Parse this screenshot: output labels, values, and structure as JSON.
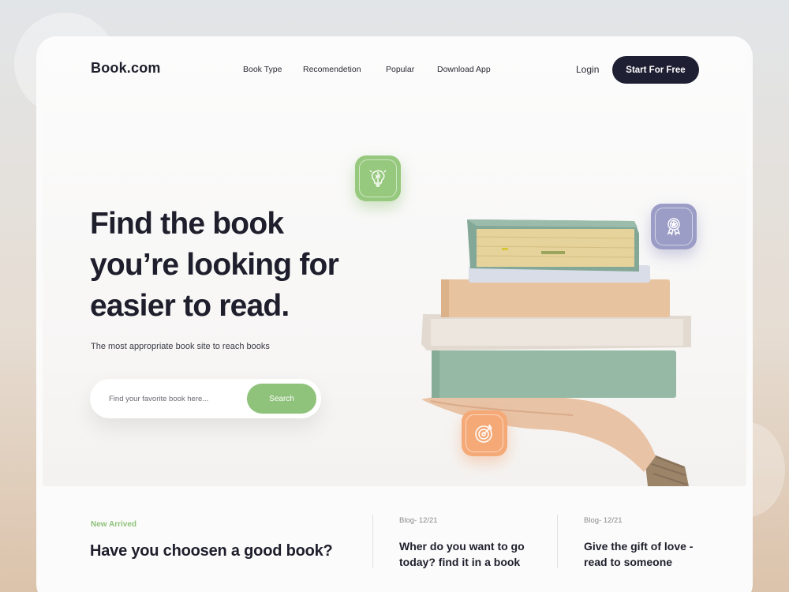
{
  "brand": {
    "logo": "Book.com"
  },
  "nav": {
    "links": [
      "Book Type",
      "Recomendetion",
      "Popular",
      "Download App"
    ],
    "login": "Login",
    "cta": "Start For Free"
  },
  "hero": {
    "title_line1": "Find the book",
    "title_line2": "you’re looking for",
    "title_line3": "easier to read.",
    "subtitle": "The most appropriate book site to reach books",
    "search": {
      "placeholder": "Find your favorite book here...",
      "button": "Search"
    }
  },
  "icons": {
    "brain": "lightbulb-brain-icon",
    "award": "award-ribbon-icon",
    "target": "target-icon"
  },
  "bottom": {
    "new_label": "New Arrived",
    "new_title": "Have you choosen a good book?",
    "blogs": [
      {
        "date": "Blog- 12/21",
        "title": "Wher do you want to go today? find it in a book"
      },
      {
        "date": "Blog- 12/21",
        "title": "Give the gift of love - read to someone"
      }
    ]
  },
  "colors": {
    "accent_green": "#8fc27a",
    "cta_dark": "#1f1f33",
    "icon_purple": "#9b9dc6",
    "icon_orange": "#f5a977"
  }
}
